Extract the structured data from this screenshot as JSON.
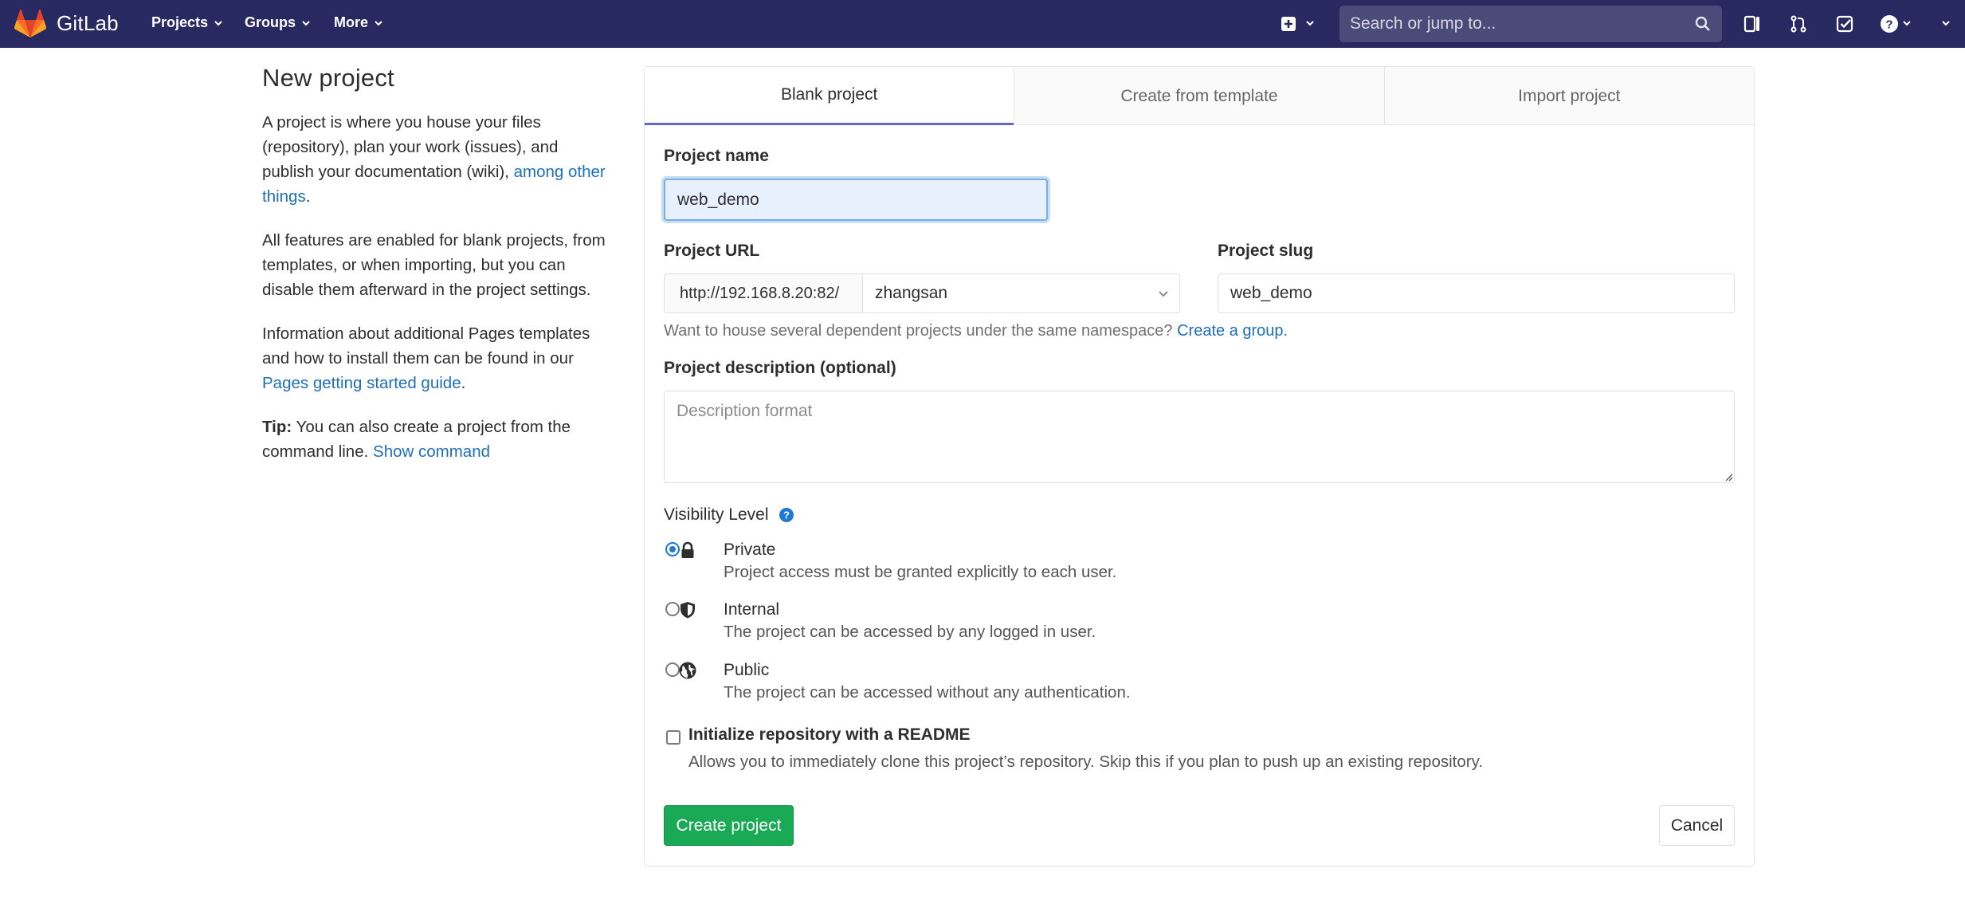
{
  "navbar": {
    "brand": "GitLab",
    "links": [
      {
        "label": "Projects"
      },
      {
        "label": "Groups"
      },
      {
        "label": "More"
      }
    ],
    "search_placeholder": "Search or jump to..."
  },
  "intro": {
    "title": "New project",
    "p1_text": "A project is where you house your files (repository), plan your work (issues), and publish your documentation (wiki), ",
    "p1_link": "among other things",
    "p1_end": ".",
    "p2_text": "All features are enabled for blank projects, from templates, or when importing, but you can disable them afterward in the project settings.",
    "p3_text": "Information about additional Pages templates and how to install them can be found in our ",
    "p3_link": "Pages getting started guide",
    "p3_end": ".",
    "tip_label": "Tip:",
    "tip_text": " You can also create a project from the command line. ",
    "tip_link": "Show command"
  },
  "tabs": [
    {
      "label": "Blank project",
      "active": true
    },
    {
      "label": "Create from template",
      "active": false
    },
    {
      "label": "Import project",
      "active": false
    }
  ],
  "form": {
    "project_name_label": "Project name",
    "project_name_value": "web_demo",
    "project_url_label": "Project URL",
    "url_prefix": "http://192.168.8.20:82/",
    "namespace": "zhangsan",
    "project_slug_label": "Project slug",
    "project_slug_value": "web_demo",
    "namespace_hint": "Want to house several dependent projects under the same namespace? ",
    "namespace_hint_link": "Create a group.",
    "description_label": "Project description (optional)",
    "description_placeholder": "Description format",
    "visibility_label": "Visibility Level",
    "visibility": [
      {
        "title": "Private",
        "desc": "Project access must be granted explicitly to each user.",
        "checked": true,
        "icon": "lock-icon"
      },
      {
        "title": "Internal",
        "desc": "The project can be accessed by any logged in user.",
        "checked": false,
        "icon": "shield-icon"
      },
      {
        "title": "Public",
        "desc": "The project can be accessed without any authentication.",
        "checked": false,
        "icon": "globe-icon"
      }
    ],
    "readme_label": "Initialize repository with a README",
    "readme_desc": "Allows you to immediately clone this project’s repository. Skip this if you plan to push up an existing repository.",
    "create_button": "Create project",
    "cancel_button": "Cancel"
  },
  "colors": {
    "navbar": "#292961",
    "primary_button": "#1aaa55",
    "link": "#1f6fb6",
    "active_tab": "#6666c4"
  }
}
